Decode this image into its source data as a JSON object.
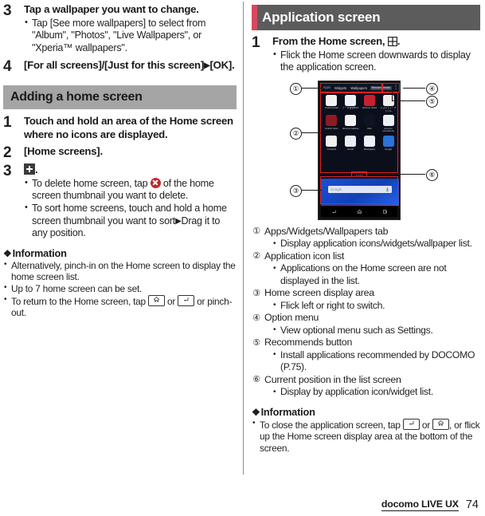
{
  "left_column": {
    "steps_continued": [
      {
        "num": "3",
        "title": "Tap a wallpaper you want to change.",
        "bullets": [
          "Tap [See more wallpapers] to select from \"Album\", \"Photos\", \"Live Wallpapers\", or \"Xperia™ wallpapers\"."
        ]
      },
      {
        "num": "4",
        "title_pre": "[For all screens]/[Just for this screen]",
        "title_arrow": "▶",
        "title_post": "[OK].",
        "bullets": []
      }
    ],
    "section": {
      "heading": "Adding a home screen",
      "steps": [
        {
          "num": "1",
          "title": "Touch and hold an area of the Home screen where no icons are displayed.",
          "bullets": []
        },
        {
          "num": "2",
          "title": "[Home screens].",
          "bullets": []
        },
        {
          "num": "3",
          "title_icon": "plus-icon",
          "title_post": ".",
          "bullets_rich": [
            {
              "pre": "To delete home screen, tap ",
              "icon": "delete-circle-icon",
              "post": " of the home screen thumbnail you want to delete."
            },
            {
              "pre": "To sort home screens, touch and hold a home screen thumbnail you want to sort",
              "arrow": "▶",
              "post": "Drag it to any position."
            }
          ]
        }
      ]
    },
    "information": {
      "heading": "Information",
      "marker": "❖",
      "items": [
        {
          "text": "Alternatively, pinch-in on the Home screen to display the home screen list."
        },
        {
          "text": "Up to 7 home screen can be set."
        },
        {
          "pre": "To return to the Home screen, tap ",
          "key1": "home-key-icon",
          "mid": " or ",
          "key2": "back-key-icon",
          "post": " or pinch-out."
        }
      ]
    }
  },
  "right_column": {
    "section": {
      "heading": "Application screen",
      "heading_bar_color": "#d9485d",
      "heading_bg_color": "#5c5c5c",
      "step": {
        "num": "1",
        "title_pre": "From the Home screen, ",
        "title_icon": "app-drawer-grid-icon",
        "title_post": ".",
        "bullets": [
          "Flick the Home screen downwards to display the application screen."
        ]
      }
    },
    "figure": {
      "name": "application-screen-diagram",
      "callouts": [
        "①",
        "②",
        "③",
        "④",
        "⑤",
        "⑥"
      ],
      "phone": {
        "tabs": [
          {
            "label": "Apps",
            "active": true
          },
          {
            "label": "Widgets",
            "active": false
          },
          {
            "label": "Wallpapers",
            "active": false
          }
        ],
        "recommends_label": "Recommends",
        "overflow_icon": "three-dot-menu-icon",
        "apps": [
          {
            "label": "Osaifu-Keitai"
          },
          {
            "label": "データ保管BOX"
          },
          {
            "label": "docomo cloud"
          },
          {
            "label": "レコメディーファイル"
          },
          {
            "label": "Anshin Scan"
          },
          {
            "label": "docomo backup"
          },
          {
            "label": "Dial"
          },
          {
            "label": "docomo phonebook"
          },
          {
            "label": "Contacts"
          },
          {
            "label": "Email"
          },
          {
            "label": "Messaging"
          },
          {
            "label": "Google"
          }
        ],
        "page_indicator": "▪▪▪▪",
        "search_placeholder": "Google",
        "mic_icon": "microphone-icon",
        "nav": [
          "back-nav-icon",
          "home-nav-icon",
          "recents-nav-icon"
        ]
      }
    },
    "callouts": [
      {
        "num": "①",
        "label": "Apps/Widgets/Wallpapers tab",
        "subs": [
          "Display application icons/widgets/wallpaper list."
        ]
      },
      {
        "num": "②",
        "label": "Application icon list",
        "subs": [
          "Applications on the Home screen are not displayed in the list."
        ]
      },
      {
        "num": "③",
        "label": "Home screen display area",
        "subs": [
          "Flick left or right to switch."
        ]
      },
      {
        "num": "④",
        "label": "Option menu",
        "subs": [
          "View optional menu such as Settings."
        ]
      },
      {
        "num": "⑤",
        "label": "Recommends button",
        "subs": [
          "Install applications recommended by DOCOMO (P.75)."
        ]
      },
      {
        "num": "⑥",
        "label": "Current position in the list screen",
        "subs": [
          "Display by application icon/widget list."
        ]
      }
    ],
    "information": {
      "heading": "Information",
      "marker": "❖",
      "items": [
        {
          "pre": "To close the application screen, tap ",
          "key1": "back-key-icon",
          "mid": " or ",
          "key2": "home-key-icon",
          "post": ", or flick up the Home screen display area at the bottom of the screen."
        }
      ]
    }
  },
  "footer": {
    "title": "docomo LIVE UX",
    "page_number": "74"
  }
}
